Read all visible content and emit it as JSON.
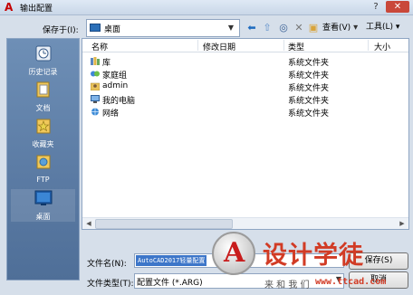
{
  "window": {
    "title": "输出配置",
    "help_glyph": "?",
    "close_glyph": "✕"
  },
  "savein": {
    "label": "保存于(I):",
    "value": "桌面"
  },
  "toolbar": {
    "view_label": "查看(V)",
    "tools_label": "工具(L)"
  },
  "places": [
    {
      "label": "历史记录",
      "icon": "history-icon"
    },
    {
      "label": "文档",
      "icon": "documents-icon"
    },
    {
      "label": "收藏夹",
      "icon": "favorites-icon"
    },
    {
      "label": "FTP",
      "icon": "ftp-icon"
    },
    {
      "label": "桌面",
      "icon": "desktop-icon",
      "active": true
    }
  ],
  "filelist": {
    "columns": [
      "名称",
      "修改日期",
      "类型",
      "大小"
    ],
    "rows": [
      {
        "name": "库",
        "type": "系统文件夹",
        "icon": "library-icon"
      },
      {
        "name": "家庭组",
        "type": "系统文件夹",
        "icon": "homegroup-icon"
      },
      {
        "name": "admin",
        "type": "系统文件夹",
        "icon": "user-folder-icon"
      },
      {
        "name": "我的电脑",
        "type": "系统文件夹",
        "icon": "computer-icon"
      },
      {
        "name": "网络",
        "type": "系统文件夹",
        "icon": "network-icon"
      }
    ]
  },
  "filename": {
    "label": "文件名(N):",
    "value": "AutoCAD2017轻量配置"
  },
  "filetype": {
    "label": "文件类型(T):",
    "value": "配置文件 (*.ARG)"
  },
  "buttons": {
    "save": "保存(S)",
    "cancel": "取消"
  },
  "watermark": {
    "logo_letter": "A",
    "title": "设计学徒",
    "subtitle": "来 和 我 们",
    "url": "www.ttcad.com"
  },
  "colors": {
    "accent": "#3d76c9",
    "panel": "#5a7aa3",
    "watermark_red": "#d13b25"
  }
}
